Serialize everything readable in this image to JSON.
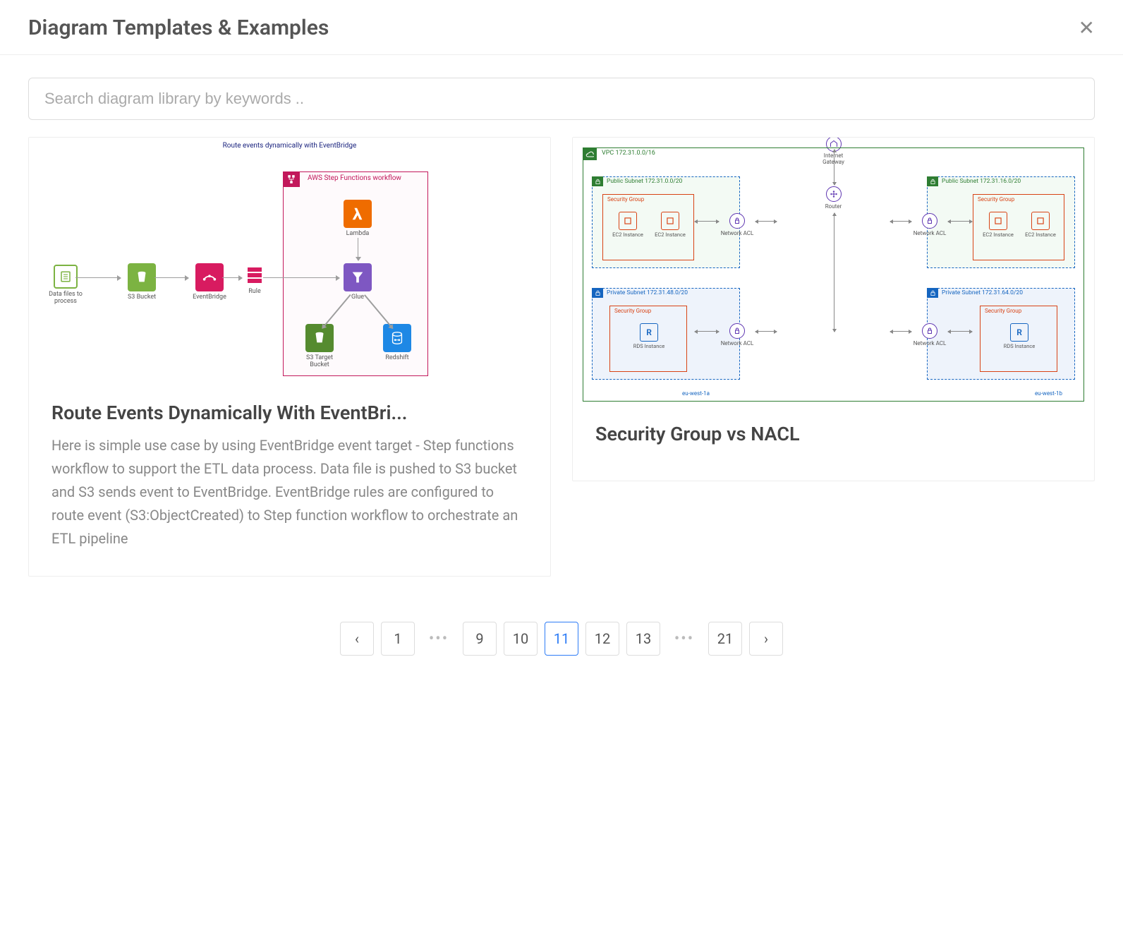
{
  "header": {
    "title": "Diagram Templates & Examples"
  },
  "search": {
    "placeholder": "Search diagram library by keywords .."
  },
  "cards": [
    {
      "title": "Route Events Dynamically With EventBri...",
      "description": "Here is simple use case by using EventBridge event target - Step functions workflow to support the ETL data process. Data file is pushed to S3 bucket and S3 sends event to EventBridge. EventBridge rules are configured to route event (S3:ObjectCreated) to Step function workflow to orchestrate an ETL pipeline",
      "diagram": {
        "caption": "Route events dynamically with EventBridge",
        "workflow_label": "AWS Step Functions workflow",
        "nodes": {
          "data_files": "Data files to process",
          "s3": "S3 Bucket",
          "eventbridge": "EventBridge",
          "rule": "Rule",
          "lambda": "Lambda",
          "glue": "Glue",
          "s3_target": "S3 Target Bucket",
          "redshift": "Redshift"
        }
      }
    },
    {
      "title": "Security Group vs NACL",
      "diagram": {
        "vpc_label": "VPC 172.31.0.0/16",
        "internet_gateway": "Internet Gateway",
        "router": "Router",
        "network_acl": "Network ACL",
        "az_left": "eu-west-1a",
        "az_right": "eu-west-1b",
        "subnets": {
          "pub_left": "Public Subnet 172.31.0.0/20",
          "pub_right": "Public Subnet 172.31.16.0/20",
          "priv_left": "Private Subnet 172.31.48.0/20",
          "priv_right": "Private Subnet 172.31.64.0/20"
        },
        "sg_label": "Security Group",
        "ec2_label": "EC2 Instance",
        "rds_label": "RDS Instance"
      }
    }
  ],
  "pagination": {
    "prev": "‹",
    "next": "›",
    "ellipsis": "•••",
    "pages": [
      "1",
      "9",
      "10",
      "11",
      "12",
      "13",
      "21"
    ],
    "active": "11"
  }
}
